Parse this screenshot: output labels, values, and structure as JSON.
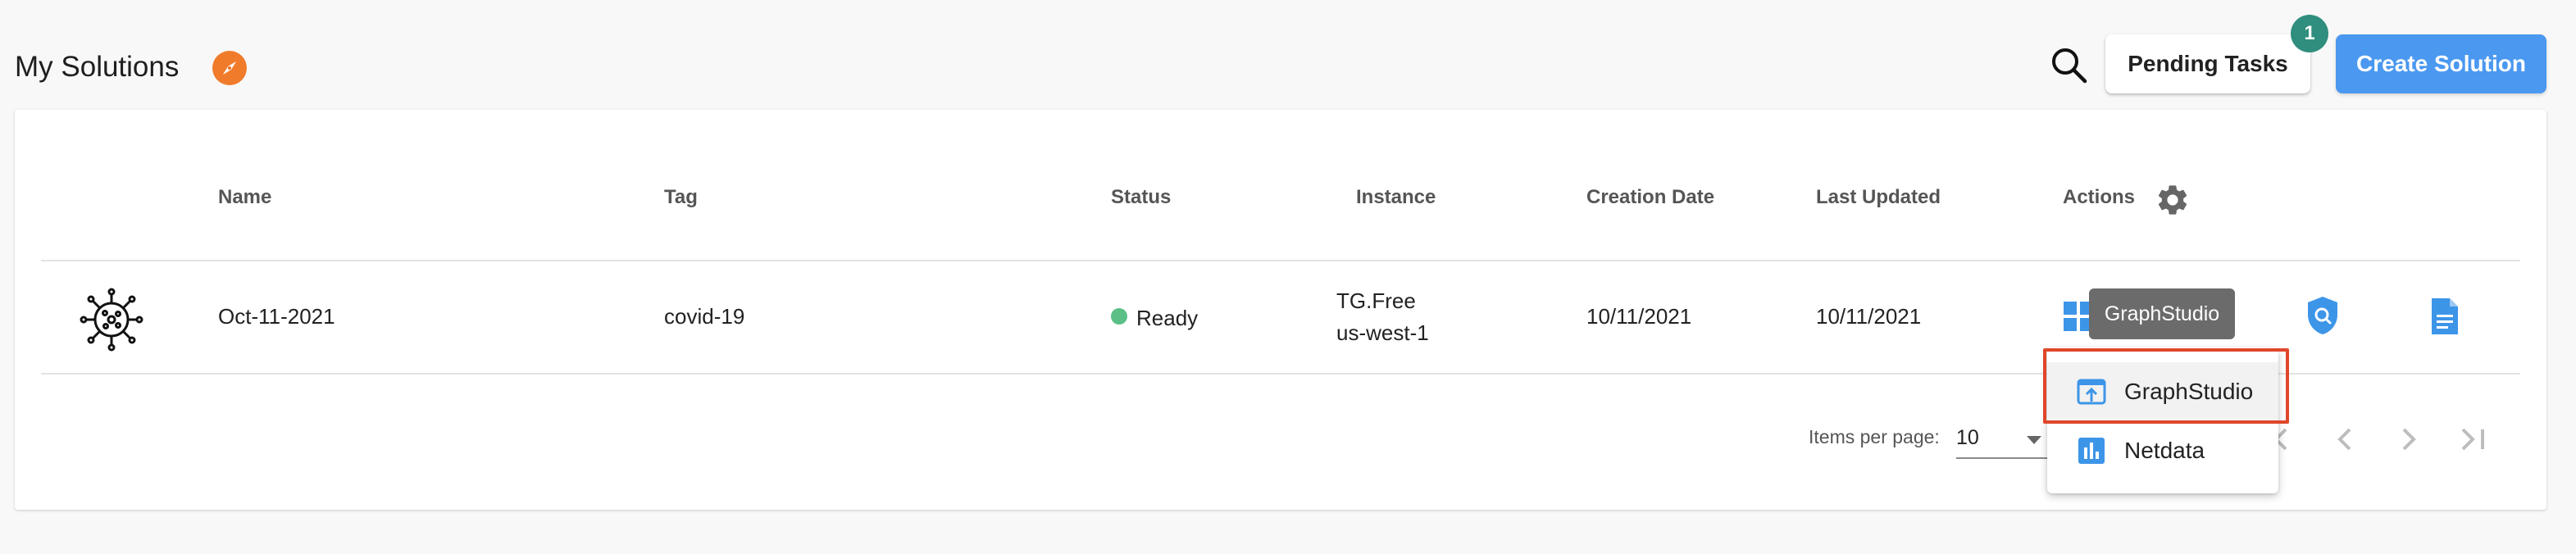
{
  "header": {
    "title": "My Solutions",
    "pending_label": "Pending Tasks",
    "pending_count": "1",
    "create_label": "Create Solution"
  },
  "table": {
    "columns": [
      "Name",
      "Tag",
      "Status",
      "Instance",
      "Creation Date",
      "Last Updated",
      "Actions"
    ],
    "rows": [
      {
        "name": "Oct-11-2021",
        "tag": "covid-19",
        "status": "Ready",
        "instance_line1": "TG.Free",
        "instance_line2": "us-west-1",
        "created": "10/11/2021",
        "updated": "10/11/2021",
        "partial_action_text": "…"
      }
    ]
  },
  "tooltip": "GraphStudio",
  "menu": {
    "items": [
      {
        "label": "GraphStudio",
        "icon": "upload-window-icon"
      },
      {
        "label": "Netdata",
        "icon": "bar-chart-icon"
      }
    ]
  },
  "paginator": {
    "label": "Items per page:",
    "value": "10"
  },
  "colors": {
    "primary": "#4a98f0",
    "badge": "#2f8e7d",
    "compass": "#f07b2b",
    "ready": "#5cbf85",
    "highlight": "#e0462a",
    "icon_blue": "#3d95e8"
  }
}
